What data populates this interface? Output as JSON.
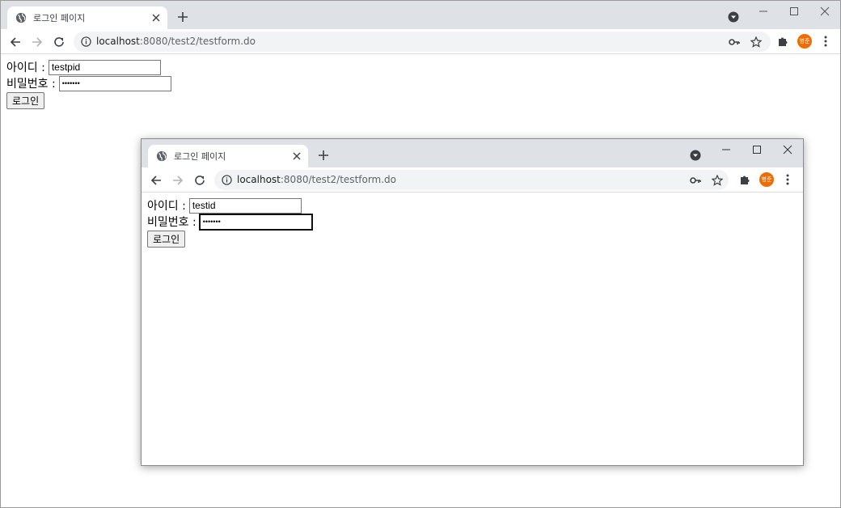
{
  "colors": {
    "tabstrip": "#dee1e6",
    "omnibox": "#f1f3f4",
    "avatar": "#ef6c00",
    "icon": "#5f6368"
  },
  "icons": [
    "globe-icon",
    "close-icon",
    "plus-icon",
    "tab-search-icon",
    "minimize-icon",
    "maximize-icon",
    "back-arrow-icon",
    "forward-arrow-icon",
    "reload-icon",
    "info-icon",
    "key-icon",
    "star-icon",
    "puzzle-icon",
    "more-vert-icon"
  ],
  "main_window": {
    "tab_title": "로그인 페이지",
    "url_host": "localhost",
    "url_path": ":8080/test2/testform.do",
    "profile_initials": "병준",
    "form": {
      "id_label": "아이디 :",
      "id_value": "testpid",
      "pw_label": "비밀번호 :",
      "pw_value": "•••••••",
      "login_button": "로그인"
    }
  },
  "popup_window": {
    "tab_title": "로그인 페이지",
    "url_host": "localhost",
    "url_path": ":8080/test2/testform.do",
    "profile_initials": "병준",
    "form": {
      "id_label": "아이디 :",
      "id_value": "testid",
      "pw_label": "비밀번호 :",
      "pw_value": "•••••••",
      "login_button": "로그인"
    }
  }
}
